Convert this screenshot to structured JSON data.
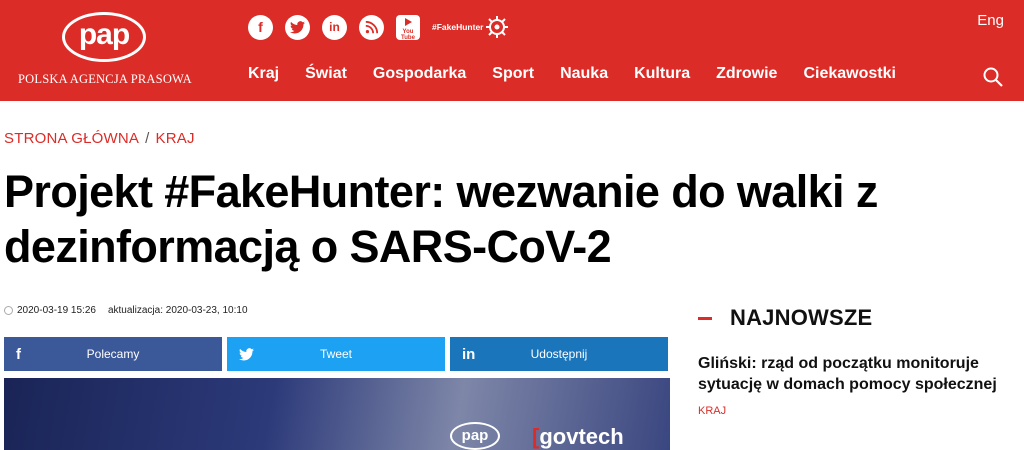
{
  "header": {
    "logo_word": "pap",
    "logo_sub": "POLSKA AGENCJA PRASOWA",
    "social": {
      "facebook_glyph": "f",
      "twitter_glyph": "t",
      "linkedin_glyph": "in",
      "rss_glyph": ")",
      "youtube_text": "You Tube",
      "fakehunter": "#FakeHunter"
    },
    "lang": "Eng",
    "nav": [
      "Kraj",
      "Świat",
      "Gospodarka",
      "Sport",
      "Nauka",
      "Kultura",
      "Zdrowie",
      "Ciekawostki"
    ],
    "accent": "#db2c27"
  },
  "breadcrumb": {
    "home": "STRONA GŁÓWNA",
    "separator": "/",
    "section": "KRAJ"
  },
  "article": {
    "title": "Projekt #FakeHunter: wezwanie do walki z dezinformacją o SARS-CoV-2",
    "published": "2020-03-19 15:26",
    "updated": "aktualizacja: 2020-03-23, 10:10"
  },
  "share": {
    "facebook": {
      "icon": "f",
      "label": "Polecamy",
      "color": "#3b5998"
    },
    "twitter": {
      "icon": "t",
      "label": "Tweet",
      "color": "#1da1f2"
    },
    "linkedin": {
      "icon": "in",
      "label": "Udostępnij",
      "color": "#1b75bb"
    }
  },
  "hero": {
    "logo_pap": "pap",
    "logo_govtech": "govtech"
  },
  "sidebar": {
    "title": "NAJNOWSZE",
    "items": [
      {
        "title": "Gliński: rząd od początku monitoruje sytuację w domach pomocy społecznej",
        "tag": "KRAJ"
      }
    ]
  }
}
